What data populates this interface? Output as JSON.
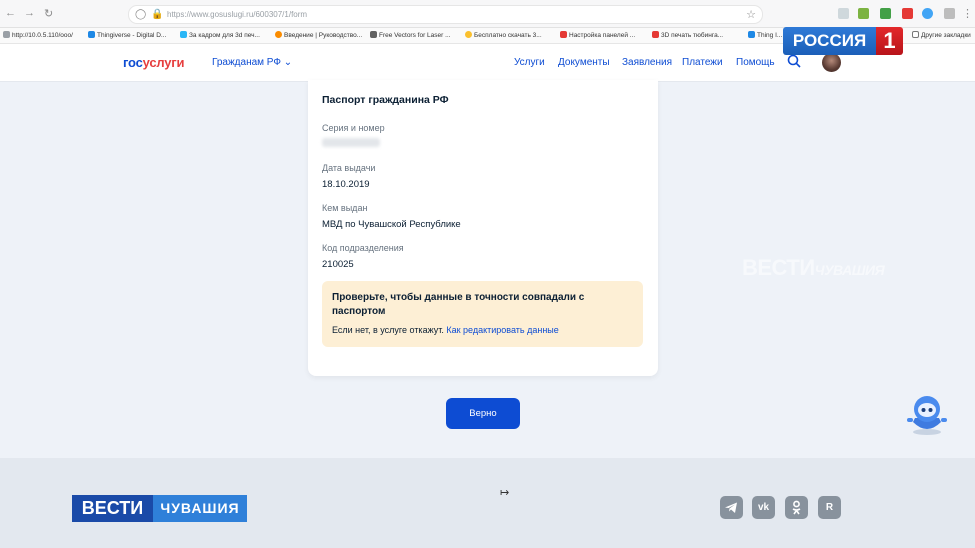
{
  "browser": {
    "url": "https://www.gosuslugi.ru/600307/1/form",
    "bookmarks": [
      {
        "label": "http://10.0.5.110/ooo/",
        "color": "#9aa0a6"
      },
      {
        "label": "Thingiverse - Digital D...",
        "color": "#1e88e5"
      },
      {
        "label": "За кадром для 3d печ...",
        "color": "#29b6f6"
      },
      {
        "label": "Введение | Руководство...",
        "color": "#fb8c00"
      },
      {
        "label": "Free Vectors for Laser ...",
        "color": "#616161"
      },
      {
        "label": "Бесплатно скачать 3...",
        "color": "#fbc02d"
      },
      {
        "label": "Настройка панелей ...",
        "color": "#e53935"
      },
      {
        "label": "3D печать тюбинга...",
        "color": "#e53935"
      },
      {
        "label": "Thing I...",
        "color": "#1e88e5"
      },
      {
        "label": "Другие закладки",
        "color": "#9aa0a6"
      }
    ]
  },
  "header": {
    "logo_part1": "гос",
    "logo_part2": "услуги",
    "audience": "Гражданам РФ",
    "menu": [
      "Услуги",
      "Документы",
      "Заявления",
      "Платежи",
      "Помощь"
    ]
  },
  "tv": {
    "channel": "РОССИЯ",
    "number": "1",
    "watermark_main": "ВЕСТИ",
    "watermark_sub": "ЧУВАШИЯ",
    "footer_main": "ВЕСТИ",
    "footer_sub": "ЧУВАШИЯ"
  },
  "card": {
    "title": "Паспорт гражданина РФ",
    "series_label": "Серия и номер",
    "issue_date_label": "Дата выдачи",
    "issue_date": "18.10.2019",
    "issued_by_label": "Кем выдан",
    "issued_by": "МВД по Чувашской Республике",
    "dept_code_label": "Код подразделения",
    "dept_code": "210025",
    "notice_title": "Проверьте, чтобы данные в точности совпадали с паспортом",
    "notice_text": "Если нет, в услуге откажут.",
    "notice_link": "Как редактировать данные"
  },
  "confirm_button": "Верно",
  "footer_social": [
    "telegram-icon",
    "vk-icon",
    "ok-icon",
    "rutube-icon"
  ],
  "colors": {
    "brand_blue": "#0d4cd3",
    "brand_red": "#e63e3e",
    "notice_bg": "#fdefd5"
  }
}
